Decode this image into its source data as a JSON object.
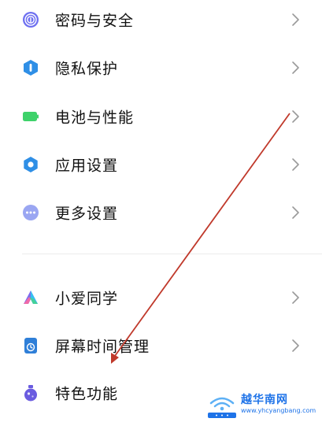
{
  "settings": {
    "items": [
      {
        "label": "密码与安全",
        "icon": "fingerprint-icon"
      },
      {
        "label": "隐私保护",
        "icon": "privacy-shield-icon"
      },
      {
        "label": "电池与性能",
        "icon": "battery-icon"
      },
      {
        "label": "应用设置",
        "icon": "gear-icon"
      },
      {
        "label": "更多设置",
        "icon": "more-dots-icon"
      },
      {
        "label": "小爱同学",
        "icon": "xiaoai-icon"
      },
      {
        "label": "屏幕时间管理",
        "icon": "screen-time-icon"
      },
      {
        "label": "特色功能",
        "icon": "feature-flask-icon"
      }
    ]
  },
  "colors": {
    "security": "#6d6ff0",
    "privacy": "#2f8fe6",
    "battery": "#3ed26a",
    "apps": "#2f8fe6",
    "more": "#9aa6f2",
    "screen_time": "#2f7fd8",
    "features": "#6a5ce0",
    "arrow": "#c0392b",
    "watermark": "#1e73e8"
  },
  "watermark": {
    "title": "越华南网",
    "url": "www.yhcyangbang.com"
  }
}
